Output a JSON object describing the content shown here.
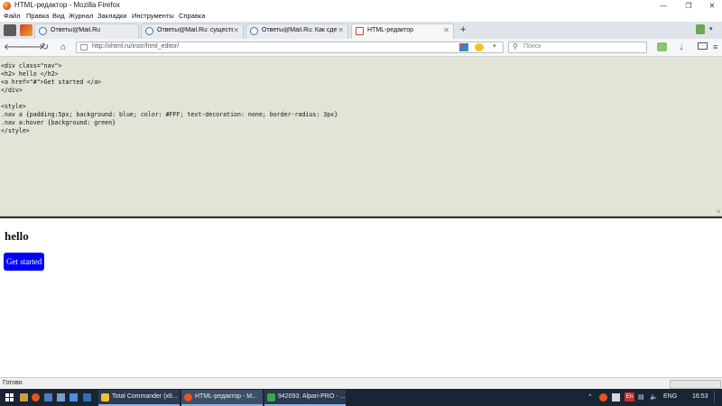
{
  "window": {
    "title": "HTML-редактор - Mozilla Firefox"
  },
  "menu": [
    "Файл",
    "Правка",
    "Вид",
    "Журнал",
    "Закладки",
    "Инструменты",
    "Справка"
  ],
  "tabs": [
    {
      "label": "Ответы@Mail.Ru",
      "active": false
    },
    {
      "label": "Ответы@Mail.Ru: существ...",
      "active": false
    },
    {
      "label": "Ответы@Mail.Ru: Как сде...",
      "active": false
    },
    {
      "label": "HTML-редактор",
      "active": true
    }
  ],
  "new_tab_symbol": "+",
  "nav": {
    "url": "http://xhtml.ru/instr/html_editor/",
    "search_placeholder": "Поиск"
  },
  "editor": {
    "code": "<div class=\"nav\">\n<h2> hello </h2>\n<a href=\"#\">Get started </a>\n</div>\n\n<style>\n.nav a {padding:5px; background: blue; color: #FFF; text-decoration: none; border-radius: 3px}\n.nav a:hover {background: green}\n</style>"
  },
  "preview": {
    "heading": "hello",
    "link_label": "Get started",
    "link_bg": "#0000ff"
  },
  "status": {
    "text": "Готово"
  },
  "taskbar": {
    "apps": [
      {
        "label": "Total Commander (x6...",
        "color": "#f2c230"
      },
      {
        "label": "HTML-редактор - M...",
        "color": "#e8531e"
      },
      {
        "label": "942093: Alpari-PRO - ...",
        "color": "#3aa655"
      }
    ],
    "lang": "ENG",
    "time": "16:53",
    "en": "En"
  }
}
